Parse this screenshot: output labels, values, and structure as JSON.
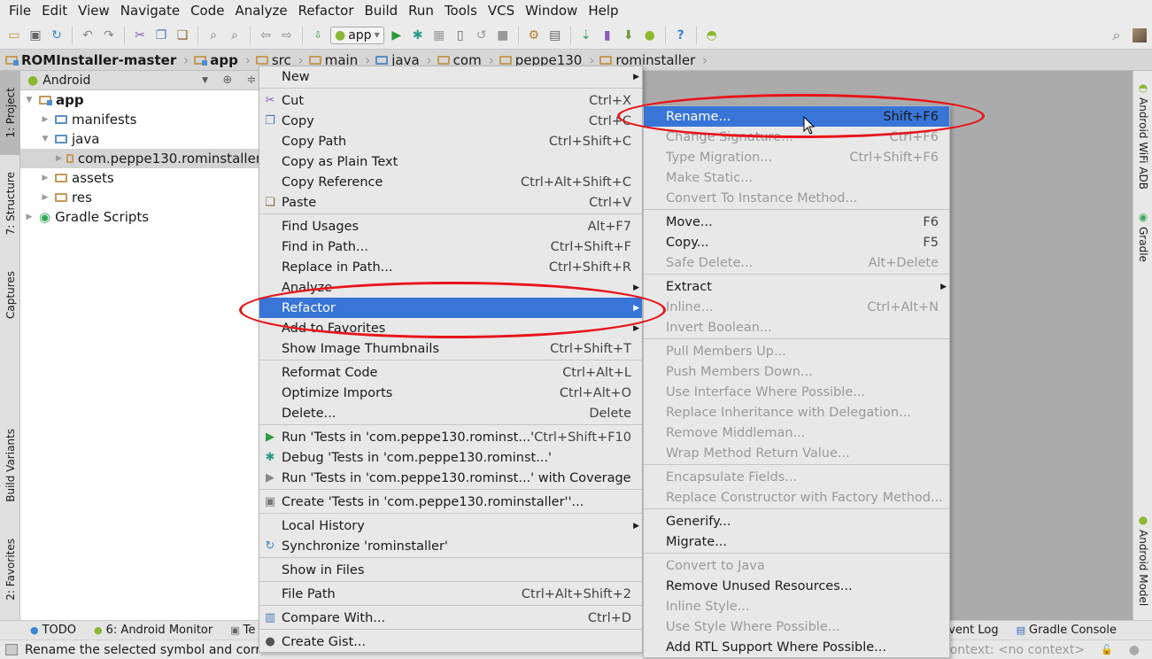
{
  "menubar": [
    "File",
    "Edit",
    "View",
    "Navigate",
    "Code",
    "Analyze",
    "Refactor",
    "Build",
    "Run",
    "Tools",
    "VCS",
    "Window",
    "Help"
  ],
  "toolbar": {
    "run_config": "app",
    "icons": [
      "open-folder-icon",
      "save-icon",
      "sync-icon",
      "undo-icon",
      "redo-icon",
      "cut-icon",
      "copy-icon",
      "paste-icon",
      "find-icon",
      "replace-icon",
      "back-icon",
      "forward-icon",
      "make-project-icon",
      "run-config-dropdown",
      "run-icon",
      "debug-icon",
      "coverage-icon",
      "device-icon",
      "rerun-icon",
      "stop-icon",
      "project-structure-icon",
      "sdk-manager-icon",
      "avd-sync-icon",
      "avd-manager-icon",
      "android-device-monitor-icon",
      "android-icon",
      "help-icon",
      "wifi-adb-icon"
    ]
  },
  "breadcrumb": [
    "ROMInstaller-master",
    "app",
    "src",
    "main",
    "java",
    "com",
    "peppe130",
    "rominstaller"
  ],
  "left_strip": {
    "tabs": [
      "1: Project",
      "7: Structure",
      "Captures",
      "Build Variants",
      "2: Favorites"
    ]
  },
  "right_strip": {
    "tabs": [
      "Android WiFi ADB",
      "Gradle",
      "Android Model"
    ]
  },
  "project_panel": {
    "view_mode": "Android",
    "tree": [
      {
        "label": "app",
        "level": 0,
        "expanded": true,
        "bold": true
      },
      {
        "label": "manifests",
        "level": 1,
        "expanded": false
      },
      {
        "label": "java",
        "level": 1,
        "expanded": true
      },
      {
        "label": "com.peppe130.rominstaller",
        "level": 2,
        "expanded": false,
        "selected": true
      },
      {
        "label": "assets",
        "level": 1,
        "expanded": false
      },
      {
        "label": "res",
        "level": 1,
        "expanded": false
      },
      {
        "label": "Gradle Scripts",
        "level": 0,
        "expanded": false
      }
    ]
  },
  "context_menu": {
    "items": [
      {
        "label": "New",
        "shortcut": "",
        "submenu": true
      },
      {
        "sep": true
      },
      {
        "label": "Cut",
        "shortcut": "Ctrl+X",
        "icon": "cut-icon"
      },
      {
        "label": "Copy",
        "shortcut": "Ctrl+C",
        "icon": "copy-icon"
      },
      {
        "label": "Copy Path",
        "shortcut": "Ctrl+Shift+C"
      },
      {
        "label": "Copy as Plain Text",
        "shortcut": ""
      },
      {
        "label": "Copy Reference",
        "shortcut": "Ctrl+Alt+Shift+C"
      },
      {
        "label": "Paste",
        "shortcut": "Ctrl+V",
        "icon": "paste-icon"
      },
      {
        "sep": true
      },
      {
        "label": "Find Usages",
        "shortcut": "Alt+F7"
      },
      {
        "label": "Find in Path...",
        "shortcut": "Ctrl+Shift+F"
      },
      {
        "label": "Replace in Path...",
        "shortcut": "Ctrl+Shift+R"
      },
      {
        "label": "Analyze",
        "shortcut": "",
        "submenu": true
      },
      {
        "label": "Refactor",
        "shortcut": "",
        "submenu": true,
        "highlighted": true
      },
      {
        "label": "Add to Favorites",
        "shortcut": "",
        "submenu": true
      },
      {
        "label": "Show Image Thumbnails",
        "shortcut": "Ctrl+Shift+T"
      },
      {
        "sep": true
      },
      {
        "label": "Reformat Code",
        "shortcut": "Ctrl+Alt+L"
      },
      {
        "label": "Optimize Imports",
        "shortcut": "Ctrl+Alt+O"
      },
      {
        "label": "Delete...",
        "shortcut": "Delete"
      },
      {
        "sep": true
      },
      {
        "label": "Run 'Tests in 'com.peppe130.rominst...'",
        "shortcut": "Ctrl+Shift+F10",
        "icon": "run-icon"
      },
      {
        "label": "Debug 'Tests in 'com.peppe130.rominst...'",
        "shortcut": "",
        "icon": "debug-icon"
      },
      {
        "label": "Run 'Tests in 'com.peppe130.rominst...' with Coverage",
        "shortcut": "",
        "icon": "coverage-icon"
      },
      {
        "sep": true
      },
      {
        "label": "Create 'Tests in 'com.peppe130.rominstaller''...",
        "shortcut": "",
        "icon": "create-test-icon"
      },
      {
        "sep": true
      },
      {
        "label": "Local History",
        "shortcut": "",
        "submenu": true
      },
      {
        "label": "Synchronize 'rominstaller'",
        "shortcut": "",
        "icon": "sync-icon"
      },
      {
        "sep": true
      },
      {
        "label": "Show in Files",
        "shortcut": ""
      },
      {
        "sep": true
      },
      {
        "label": "File Path",
        "shortcut": "Ctrl+Alt+Shift+2"
      },
      {
        "sep": true
      },
      {
        "label": "Compare With...",
        "shortcut": "Ctrl+D",
        "icon": "compare-icon"
      },
      {
        "sep": true
      },
      {
        "label": "Create Gist...",
        "shortcut": "",
        "icon": "github-icon"
      }
    ]
  },
  "refactor_submenu": {
    "items": [
      {
        "label": "Rename...",
        "shortcut": "Shift+F6",
        "highlighted": true
      },
      {
        "label": "Change Signature...",
        "shortcut": "Ctrl+F6",
        "disabled": true
      },
      {
        "label": "Type Migration...",
        "shortcut": "Ctrl+Shift+F6",
        "disabled": true
      },
      {
        "label": "Make Static...",
        "shortcut": "",
        "disabled": true
      },
      {
        "label": "Convert To Instance Method...",
        "shortcut": "",
        "disabled": true
      },
      {
        "sep": true
      },
      {
        "label": "Move...",
        "shortcut": "F6"
      },
      {
        "label": "Copy...",
        "shortcut": "F5"
      },
      {
        "label": "Safe Delete...",
        "shortcut": "Alt+Delete",
        "disabled": true
      },
      {
        "sep": true
      },
      {
        "label": "Extract",
        "shortcut": "",
        "submenu": true
      },
      {
        "label": "Inline...",
        "shortcut": "Ctrl+Alt+N",
        "disabled": true
      },
      {
        "label": "Invert Boolean...",
        "shortcut": "",
        "disabled": true
      },
      {
        "sep": true
      },
      {
        "label": "Pull Members Up...",
        "shortcut": "",
        "disabled": true
      },
      {
        "label": "Push Members Down...",
        "shortcut": "",
        "disabled": true
      },
      {
        "label": "Use Interface Where Possible...",
        "shortcut": "",
        "disabled": true
      },
      {
        "label": "Replace Inheritance with Delegation...",
        "shortcut": "",
        "disabled": true
      },
      {
        "label": "Remove Middleman...",
        "shortcut": "",
        "disabled": true
      },
      {
        "label": "Wrap Method Return Value...",
        "shortcut": "",
        "disabled": true
      },
      {
        "sep": true
      },
      {
        "label": "Encapsulate Fields...",
        "shortcut": "",
        "disabled": true
      },
      {
        "label": "Replace Constructor with Factory Method...",
        "shortcut": "",
        "disabled": true
      },
      {
        "sep": true
      },
      {
        "label": "Generify...",
        "shortcut": ""
      },
      {
        "label": "Migrate...",
        "shortcut": ""
      },
      {
        "sep": true
      },
      {
        "label": "Convert to Java",
        "shortcut": "",
        "disabled": true
      },
      {
        "label": "Remove Unused Resources...",
        "shortcut": ""
      },
      {
        "label": "Inline Style...",
        "shortcut": "",
        "disabled": true
      },
      {
        "label": "Use Style Where Possible...",
        "shortcut": "",
        "disabled": true
      },
      {
        "label": "Add RTL Support Where Possible...",
        "shortcut": ""
      }
    ]
  },
  "bottom_tabs": {
    "left": [
      "TODO",
      "6: Android Monitor",
      "Te"
    ],
    "right": [
      "Event Log",
      "Gradle Console"
    ]
  },
  "status": {
    "message": "Rename the selected symbol and corr",
    "context": "Context: <no context>"
  },
  "colors": {
    "highlight": "#3875d7",
    "annotation": "#e8141b",
    "editor_bg": "#ababab"
  }
}
